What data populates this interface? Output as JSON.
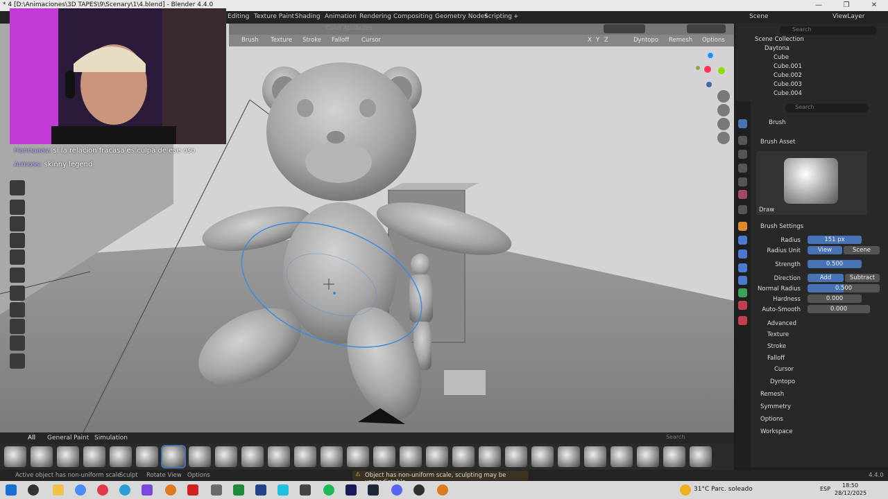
{
  "window": {
    "title": "* 4 [D:\\Animaciones\\3D TAPES\\9\\Scenary\\1\\4.blend] - Blender 4.4.0",
    "minimize": "—",
    "maximize": "❐",
    "close": "✕"
  },
  "workspace_tabs": [
    "Editing",
    "Texture Paint",
    "Shading",
    "Animation",
    "Rendering",
    "Compositing",
    "Geometry Nodes",
    "Scripting",
    "+"
  ],
  "scene": {
    "scene_name": "Scene",
    "view_layer": "ViewLayer",
    "search_placeholder": "Search"
  },
  "viewport_header": {
    "color_attributes": "Color Attributes",
    "menus": [
      "Brush",
      "Texture",
      "Stroke",
      "Falloff",
      "Cursor"
    ],
    "axes": [
      "X",
      "Y",
      "Z"
    ],
    "dyntopo": "Dyntopo",
    "remesh": "Remesh",
    "options": "Options"
  },
  "chat": [
    {
      "user": "Hannaaav:",
      "message": "si la relacion fracasa es culpa de ese oso"
    },
    {
      "user": "Armoss:",
      "message": "skinny legend"
    }
  ],
  "outliner": {
    "root": "Scene Collection",
    "collection": "Daytona",
    "objects": [
      "Cube",
      "Cube.001",
      "Cube.002",
      "Cube.003",
      "Cube.004"
    ]
  },
  "properties": {
    "search_placeholder": "Search",
    "header": "Brush",
    "brush_asset_label": "Brush Asset",
    "brush_name": "Draw",
    "brush_settings_label": "Brush Settings",
    "radius_label": "Radius",
    "radius_value": "151 px",
    "radius_unit_label": "Radius Unit",
    "radius_unit_options": [
      "View",
      "Scene"
    ],
    "strength_label": "Strength",
    "strength_value": "0.500",
    "direction_label": "Direction",
    "direction_options": [
      "Add",
      "Subtract"
    ],
    "normal_radius_label": "Normal Radius",
    "normal_radius_value": "0.500",
    "hardness_label": "Hardness",
    "hardness_value": "0.000",
    "auto_smooth_label": "Auto-Smooth",
    "auto_smooth_value": "0.000",
    "subpanels": [
      "Advanced",
      "Texture",
      "Stroke",
      "Falloff",
      "Cursor"
    ],
    "panels": [
      "Dyntopo",
      "Remesh",
      "Symmetry",
      "Options",
      "Workspace"
    ]
  },
  "shelf": {
    "tabs": [
      "All",
      "General",
      "Paint",
      "Simulation"
    ],
    "search_placeholder": "Search",
    "brush_count": 27
  },
  "status": {
    "left_message": "Active object has non-uniform scale",
    "sculpt": "Sculpt",
    "rotate_view": "Rotate View",
    "options": "Options",
    "warning": "Object has non-uniform scale, sculpting may be unpredictable",
    "version": "4.4.0"
  },
  "taskbar": {
    "weather": "31°C  Parc. soleado",
    "lang": "ESP",
    "time": "18:50",
    "date": "28/12/2025"
  },
  "colors": {
    "accent": "#4772b3",
    "viewport": "#6e6e6e",
    "brush_ring": "#3d8be0"
  }
}
